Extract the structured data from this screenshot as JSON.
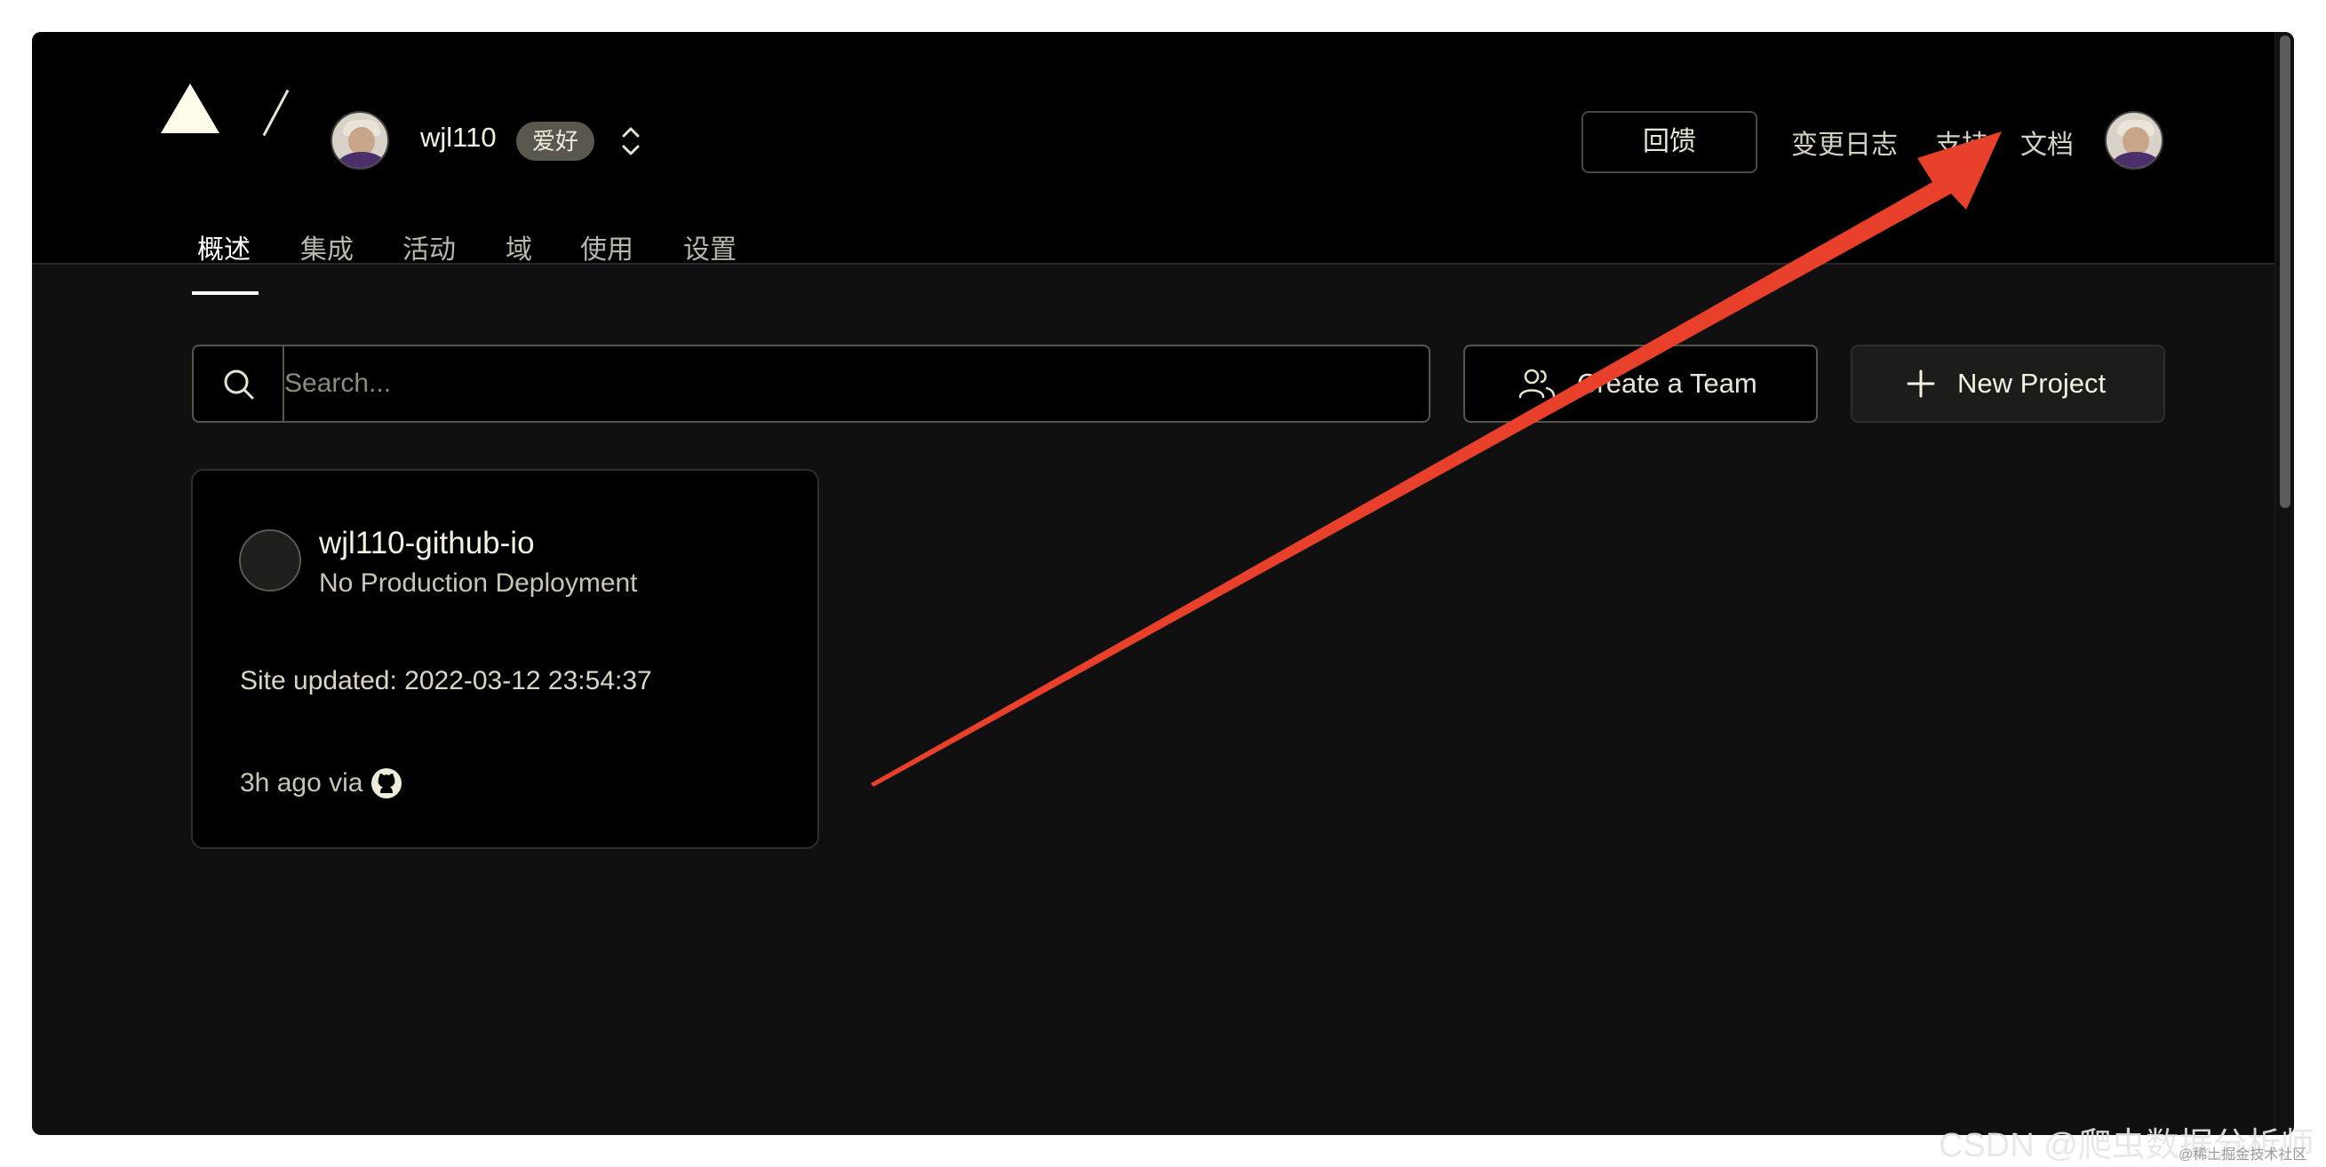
{
  "header": {
    "username": "wjl110",
    "badge": "爱好",
    "nav_links": [
      "回馈",
      "变更日志",
      "支持",
      "文档"
    ]
  },
  "tabs": [
    {
      "label": "概述",
      "active": true
    },
    {
      "label": "集成",
      "active": false
    },
    {
      "label": "活动",
      "active": false
    },
    {
      "label": "域",
      "active": false
    },
    {
      "label": "使用",
      "active": false
    },
    {
      "label": "设置",
      "active": false
    }
  ],
  "toolbar": {
    "search_placeholder": "Search...",
    "create_team_label": "Create a Team",
    "new_project_label": "New Project"
  },
  "project_card": {
    "name": "wjl110-github-io",
    "status": "No Production Deployment",
    "site_updated": "Site updated: 2022-03-12 23:54:37",
    "ago_via": "3h ago via"
  },
  "watermark": {
    "main": "CSDN @爬虫数据分析师",
    "secondary": "@稀土掘金技术社区"
  },
  "colors": {
    "annotation_arrow": "#e8402a",
    "background": "#101010",
    "header": "#000000"
  }
}
